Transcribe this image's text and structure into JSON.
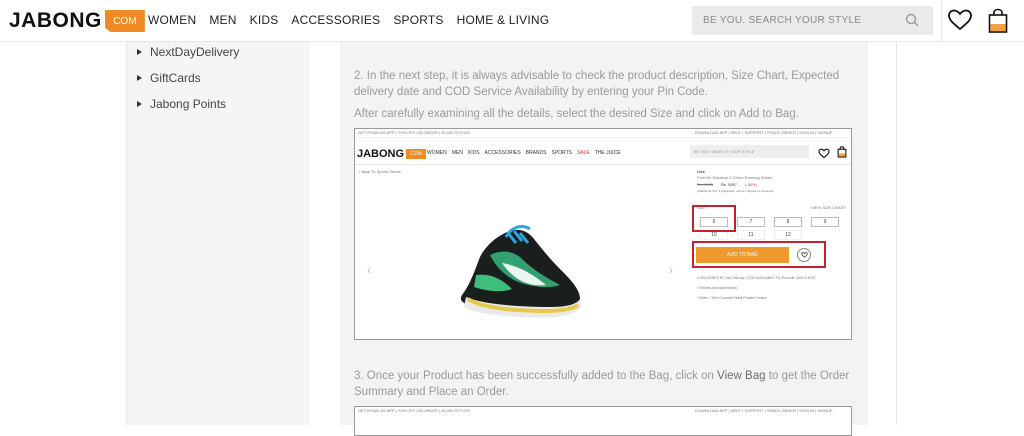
{
  "header": {
    "logo_word": "JABONG",
    "logo_badge": "COM",
    "nav": [
      "WOMEN",
      "MEN",
      "KIDS",
      "ACCESSORIES",
      "SPORTS",
      "HOME & LIVING"
    ],
    "search_placeholder": "BE YOU. SEARCH YOUR STYLE"
  },
  "sidebar": {
    "items": [
      "NextDayDelivery",
      "GiftCards",
      "Jabong Points"
    ]
  },
  "steps": {
    "step2_line1": "2. In the next step, it is always advisable to check the product description, Size Chart, Expected",
    "step2_line2": "delivery date and COD Service Availability by entering your Pin Code.",
    "step2_line3": "After carefully examining all the details, select the desired Size and click on Add to Bag.",
    "step3_part1": "3. Once your Product has been successfully added to the Bag, click on ",
    "step3_bold": "View Bag",
    "step3_part2": " to get the Order",
    "step3_line2": "Summary and Place an Order."
  },
  "screenshot": {
    "top_left": "GET RS400 AS APP • 70% OFF ON ORDER | 20,000 STYLES",
    "top_right": "DOWNLOAD APP  |  HELP / SUPPORT  |  TRACK ORDER  |  SIGN IN  |  SIGNUP",
    "logo_word": "JABONG",
    "logo_badge": "COM",
    "nav": [
      "WOMEN",
      "MEN",
      "KIDS",
      "ACCESSORIES",
      "BRANDS",
      "SPORTS",
      "SALE",
      "THE JUICE"
    ],
    "search_placeholder": "BE YOU. SEARCH YOUR STYLE",
    "back_link": "< Back To Sports Shoes",
    "brand": "Nike",
    "product_name": "Free Rn Distance 2 Green Running Shoes",
    "old_price": "Rs. 9995",
    "new_price": "Rs. 5997",
    "discount": "(-40%)",
    "tax_note": "(Additional VAT, if applicable, will be charged at checkout)",
    "size_label": "SIZE",
    "size_chart": "VIEW SIZE CHART",
    "sizes_row1": [
      "6",
      "7",
      "8",
      "9"
    ],
    "sizes_row2": [
      "10",
      "11",
      "12"
    ],
    "add_to_bag": "ADD TO BAG",
    "delivery": "• DELIVERED BY Sat 29th Apr | COD AVAILABLE   For Pincode 110019  EDIT",
    "policy": "• Policies and Authenticity",
    "seller": "• Seller : Tech Connect Retail Private Limited"
  }
}
